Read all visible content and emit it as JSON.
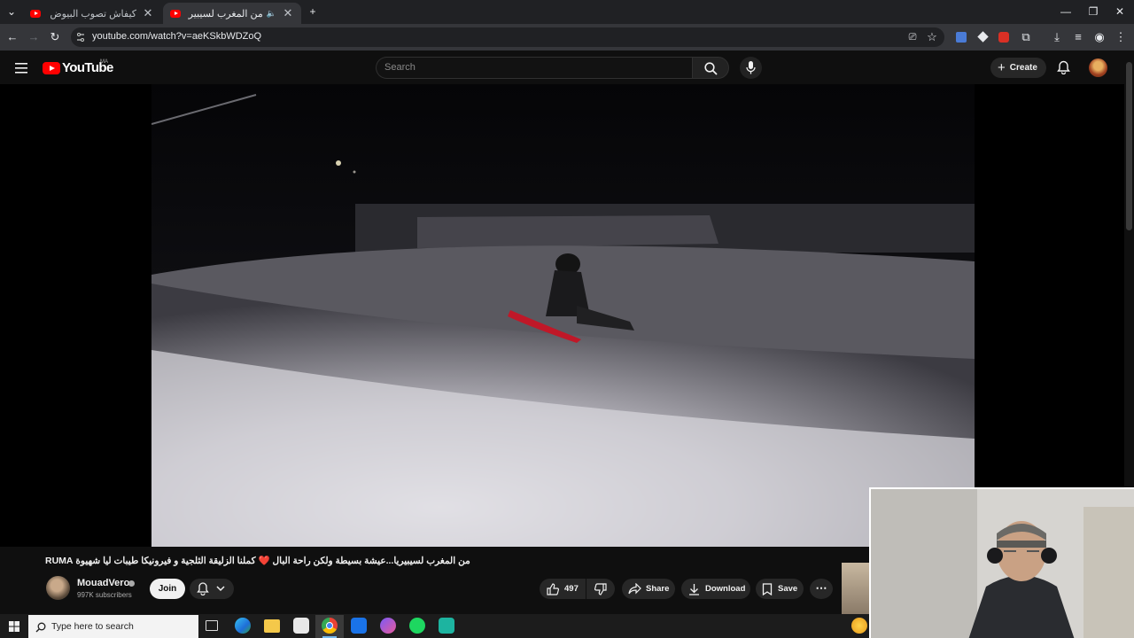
{
  "browser": {
    "tabs": [
      {
        "title": "كيفاش تصوب البيوض ب الاعشاب",
        "active": false
      },
      {
        "title": "من المغرب لسيبيريا...عيشة بسيطة",
        "active": true,
        "audio": true
      }
    ],
    "url": "youtube.com/watch?v=aeKSkbWDZoQ"
  },
  "youtube": {
    "logo_text": "YouTube",
    "country_code": "MA",
    "search_placeholder": "Search",
    "create_label": "Create"
  },
  "video": {
    "title": "من المغرب لسيبيريا...عيشة بسيطة ولكن راحة البال ❤️ كملنا الزليقة الثلجية و فيرونيكا طيبات ليا شهيوة RUMA",
    "channel_name": "MouadVero",
    "subscribers": "997K subscribers",
    "join_label": "Join",
    "likes": "497",
    "share_label": "Share",
    "download_label": "Download",
    "save_label": "Save"
  },
  "taskbar": {
    "search_placeholder": "Type here to search"
  },
  "colors": {
    "youtube_red": "#ff0000",
    "background": "#0f0f0f",
    "chip": "#272727"
  }
}
